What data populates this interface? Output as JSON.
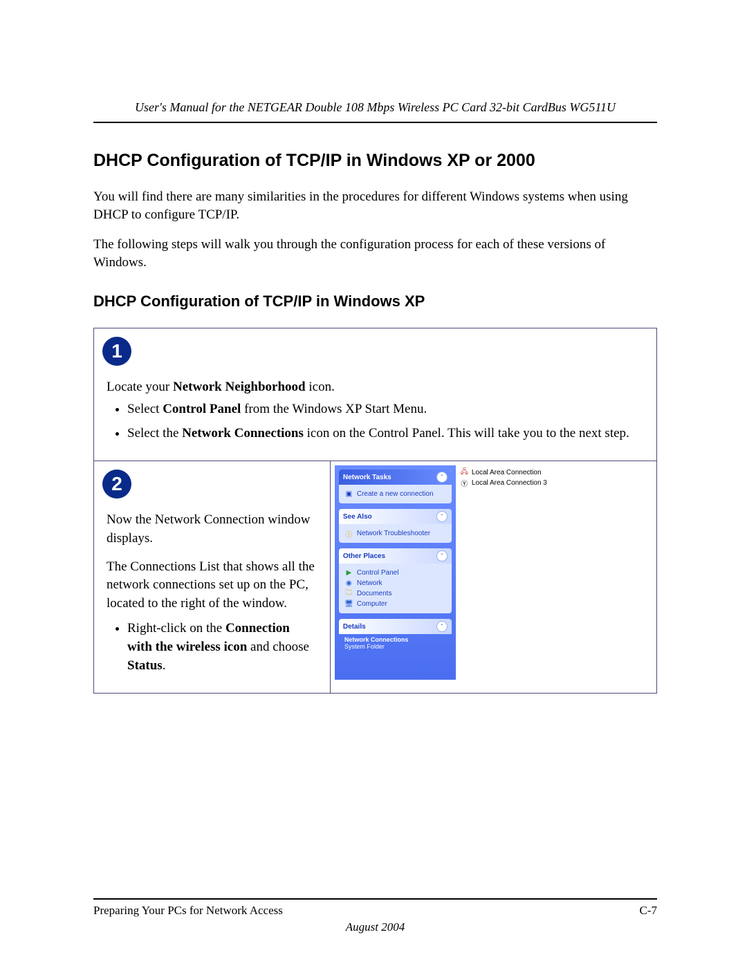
{
  "header": {
    "manual_title": "User's Manual for the NETGEAR Double 108 Mbps Wireless PC Card 32-bit CardBus WG511U"
  },
  "headings": {
    "h1": "DHCP Configuration of TCP/IP in Windows XP or 2000",
    "h2": "DHCP Configuration of TCP/IP in Windows XP"
  },
  "paragraphs": {
    "p1": "You will find there are many similarities in the procedures for different Windows systems when using DHCP to configure TCP/IP.",
    "p2": "The following steps will walk you through the configuration process for each of these versions of Windows."
  },
  "step1": {
    "badge": "1",
    "intro_pre": "Locate your ",
    "intro_bold": "Network Neighborhood",
    "intro_post": " icon.",
    "bullet1_pre": "Select ",
    "bullet1_bold": "Control Panel",
    "bullet1_post": " from the Windows XP Start Menu.",
    "bullet2_pre": "Select the ",
    "bullet2_bold": "Network Connections",
    "bullet2_post": " icon on the Control Panel.  This will take you to the next step."
  },
  "step2": {
    "badge": "2",
    "p1": "Now the Network Connection window displays.",
    "p2": "The Connections List that shows all the network connections set up on the PC, located to the right of the window.",
    "bullet_pre": "Right-click on the ",
    "bullet_bold1": "Connection with the wireless icon",
    "bullet_mid": " and choose ",
    "bullet_bold2": "Status",
    "bullet_post": "."
  },
  "xp": {
    "panels": {
      "tasks_title": "Network Tasks",
      "create_conn": "Create a new connection",
      "see_also_title": "See Also",
      "troubleshooter": "Network Troubleshooter",
      "other_places_title": "Other Places",
      "control_panel": "Control Panel",
      "network": "Network",
      "documents": "Documents",
      "computer": "Computer",
      "details_title": "Details",
      "details_bold": "Network Connections",
      "details_sub": "System Folder"
    },
    "conn1": "Local Area Connection",
    "conn3": "Local Area Connection 3"
  },
  "footer": {
    "section": "Preparing Your PCs for Network Access",
    "page": "C-7",
    "date": "August 2004"
  }
}
